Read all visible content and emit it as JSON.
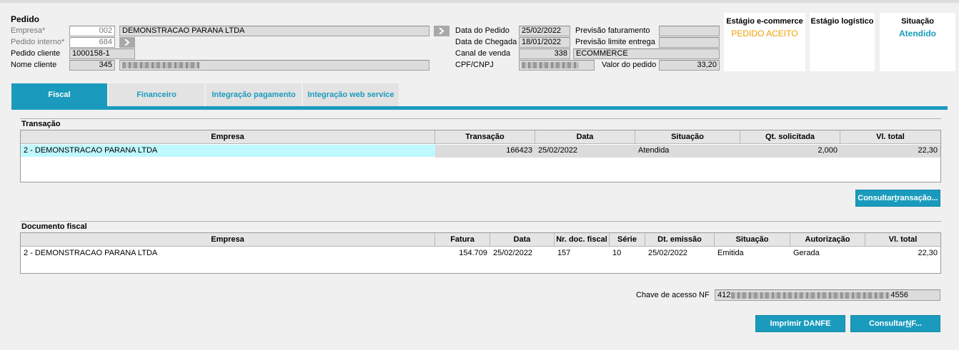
{
  "pedido": {
    "title": "Pedido",
    "empresa_label": "Empresa*",
    "empresa_code": "002",
    "empresa_name": "DEMONSTRACAO PARANA LTDA",
    "pedido_interno_label": "Pedido interno*",
    "pedido_interno": "684",
    "pedido_cliente_label": "Pedido cliente",
    "pedido_cliente": "1000158-1",
    "nome_cliente_label": "Nome cliente",
    "nome_cliente_code": "345",
    "data_pedido_label": "Data do Pedido",
    "data_pedido": "25/02/2022",
    "data_chegada_label": "Data de Chegada",
    "data_chegada": "18/01/2022",
    "canal_venda_label": "Canal de venda",
    "canal_venda_code": "338",
    "canal_venda_name": "ECOMMERCE",
    "cpf_label": "CPF/CNPJ",
    "previsao_fat_label": "Previsão faturamento",
    "previsao_entrega_label": "Previsão limite entrega",
    "valor_pedido_label": "Valor do pedido",
    "valor_pedido": "33,20"
  },
  "status": {
    "ecommerce_title": "Estágio e-commerce",
    "ecommerce_value": "PEDIDO ACEITO",
    "logistico_title": "Estágio logístico",
    "logistico_value": "",
    "situacao_title": "Situação",
    "situacao_value": "Atendido",
    "colors": {
      "ecommerce": "#f0a000",
      "situacao": "#1a9bbd"
    }
  },
  "tabs": [
    {
      "label": "Fiscal",
      "active": true
    },
    {
      "label": "Financeiro",
      "active": false
    },
    {
      "label": "Integração pagamento",
      "active": false
    },
    {
      "label": "Integração web service",
      "active": false
    }
  ],
  "transacao": {
    "title": "Transação",
    "headers": [
      "Empresa",
      "Transação",
      "Data",
      "Situação",
      "Qt. solicitada",
      "Vl. total"
    ],
    "rows": [
      [
        "2 - DEMONSTRACAO PARANA LTDA",
        "166423",
        "25/02/2022",
        "Atendida",
        "2,000",
        "22,30"
      ]
    ],
    "button_prefix": "Consultar ",
    "button_underlined": "t",
    "button_suffix": "ransação..."
  },
  "documento": {
    "title": "Documento fiscal",
    "headers": [
      "Empresa",
      "Fatura",
      "Data",
      "Nr. doc. fiscal",
      "Série",
      "Dt. emissão",
      "Situação",
      "Autorização",
      "Vl. total"
    ],
    "rows": [
      [
        "2 - DEMONSTRACAO PARANA LTDA",
        "154.709",
        "25/02/2022",
        "157",
        "10",
        "25/02/2022",
        "Emitida",
        "Gerada",
        "22,30"
      ]
    ],
    "chave_label": "Chave de acesso NF",
    "chave_start": "412",
    "chave_end": "4556",
    "imprimir_label": "Imprimir DANFE",
    "consultar_nf_prefix": "Consultar ",
    "consultar_nf_underlined": "N",
    "consultar_nf_suffix": "F..."
  },
  "colors": {
    "accent": "#1a9bbd",
    "row_highlight": "#bff8ff"
  }
}
